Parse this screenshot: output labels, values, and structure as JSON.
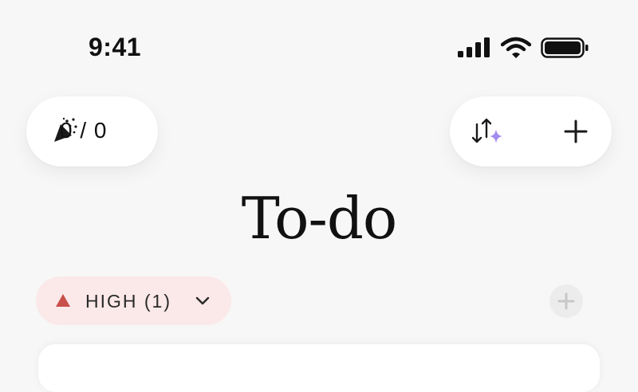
{
  "status_bar": {
    "time": "9:41"
  },
  "header": {
    "completion_counter": "0 / 0"
  },
  "page": {
    "title": "To-do"
  },
  "groups": [
    {
      "label": "HIGH",
      "count_text": "(1)",
      "display": "HIGH (1)",
      "color": "#c9504a",
      "chip_background": "#fbe8e8"
    }
  ],
  "icons": {
    "left_pill": "party-popper-icon",
    "right_pill": [
      "sort-ai-icon",
      "plus-icon"
    ],
    "group": [
      "triangle-up-icon",
      "chevron-down-icon",
      "plus-icon"
    ]
  },
  "colors": {
    "ai_sparkle": "#a28cf0",
    "priority_high": "#c9504a"
  }
}
